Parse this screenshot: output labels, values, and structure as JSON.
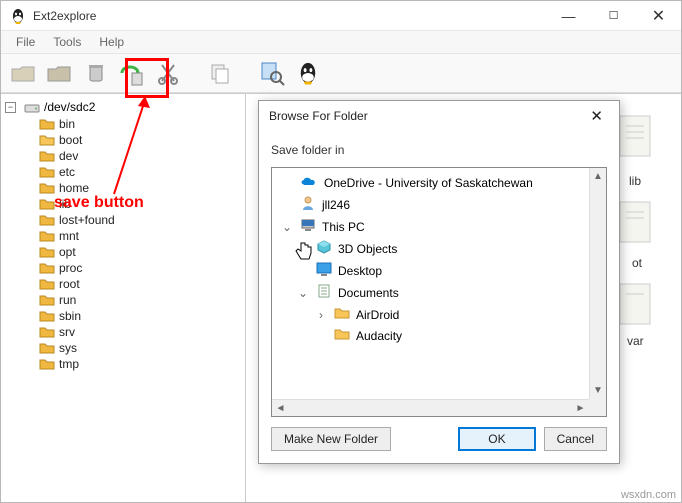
{
  "window": {
    "title": "Ext2explore",
    "min_symbol": "—",
    "max_symbol": "☐",
    "close_symbol": "✕"
  },
  "menu": {
    "file": "File",
    "tools": "Tools",
    "help": "Help"
  },
  "toolbar": {
    "open_name": "open",
    "save_name": "save",
    "cut_name": "cut",
    "copy_name": "copy",
    "search_name": "search",
    "tux_name": "linux"
  },
  "annotation": {
    "label": "save button"
  },
  "tree": {
    "root": "/dev/sdc2",
    "items": [
      {
        "label": "bin"
      },
      {
        "label": "boot",
        "selected": true
      },
      {
        "label": "dev"
      },
      {
        "label": "etc"
      },
      {
        "label": "home"
      },
      {
        "label": "lib"
      },
      {
        "label": "lost+found"
      },
      {
        "label": "mnt"
      },
      {
        "label": "opt"
      },
      {
        "label": "proc"
      },
      {
        "label": "root"
      },
      {
        "label": "run"
      },
      {
        "label": "sbin"
      },
      {
        "label": "srv"
      },
      {
        "label": "sys"
      },
      {
        "label": "tmp"
      }
    ]
  },
  "bg_labels": [
    "lib",
    "ot",
    "var"
  ],
  "dialog": {
    "title": "Browse For Folder",
    "subtitle": "Save folder in",
    "close_symbol": "✕",
    "tree": [
      {
        "icon": "onedrive",
        "label": "OneDrive - University of Saskatchewan",
        "indent": 0,
        "exp": ""
      },
      {
        "icon": "user",
        "label": "jll246",
        "indent": 0,
        "exp": ""
      },
      {
        "icon": "pc",
        "label": "This PC",
        "indent": 0,
        "exp": "v"
      },
      {
        "icon": "3d",
        "label": "3D Objects",
        "indent": 1,
        "exp": ">"
      },
      {
        "icon": "desk",
        "label": "Desktop",
        "indent": 1,
        "exp": ""
      },
      {
        "icon": "docs",
        "label": "Documents",
        "indent": 1,
        "exp": "v"
      },
      {
        "icon": "fold",
        "label": "AirDroid",
        "indent": 2,
        "exp": ">"
      },
      {
        "icon": "fold",
        "label": "Audacity",
        "indent": 2,
        "exp": ""
      }
    ],
    "make_new": "Make New Folder",
    "ok": "OK",
    "cancel": "Cancel"
  },
  "watermark": "wsxdn.com"
}
